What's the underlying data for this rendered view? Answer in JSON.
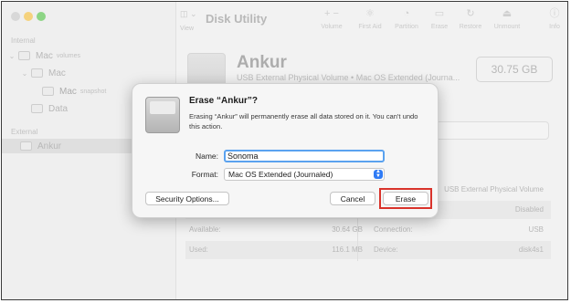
{
  "window": {
    "title": "Disk Utility",
    "toolbar": {
      "view_label": "View",
      "view_icon": "sidebar-icon",
      "tools": [
        {
          "label": "Volume",
          "icon": "plus-minus-icon"
        },
        {
          "label": "First Aid",
          "icon": "stethoscope-icon"
        },
        {
          "label": "Partition",
          "icon": "pie-icon"
        },
        {
          "label": "Erase",
          "icon": "eraser-icon"
        },
        {
          "label": "Restore",
          "icon": "restore-icon"
        },
        {
          "label": "Unmount",
          "icon": "eject-icon"
        },
        {
          "label": "Info",
          "icon": "info-icon"
        }
      ]
    }
  },
  "sidebar": {
    "internal_label": "Internal",
    "external_label": "External",
    "items": [
      {
        "label": "Mac",
        "sub": "volumes"
      },
      {
        "label": "Mac",
        "sub": ""
      },
      {
        "label": "Mac",
        "sub": "snapshot"
      },
      {
        "label": "Data",
        "sub": ""
      },
      {
        "label": "Ankur",
        "sub": ""
      }
    ]
  },
  "volume": {
    "name": "Ankur",
    "description": "USB External Physical Volume • Mac OS Extended (Journa...",
    "size": "30.75 GB"
  },
  "info": {
    "rows": [
      {
        "left_label": "",
        "left_value": "",
        "right_label": "",
        "right_value": "USB External Physical Volume"
      },
      {
        "left_label": "",
        "left_value": "",
        "right_label": "",
        "right_value": "Disabled"
      },
      {
        "left_label": "Available:",
        "left_value": "30.64 GB",
        "right_label": "Connection:",
        "right_value": "USB"
      },
      {
        "left_label": "Used:",
        "left_value": "116.1 MB",
        "right_label": "Device:",
        "right_value": "disk4s1"
      }
    ]
  },
  "sheet": {
    "title": "Erase “Ankur”?",
    "message": "Erasing “Ankur” will permanently erase all data stored on it. You can't undo this action.",
    "name_label": "Name:",
    "name_value": "Sonoma",
    "format_label": "Format:",
    "format_value": "Mac OS Extended (Journaled)",
    "security_button": "Security Options...",
    "cancel_button": "Cancel",
    "erase_button": "Erase",
    "highlight_color": "#d9332b",
    "focus_color": "#5aa2ef"
  }
}
